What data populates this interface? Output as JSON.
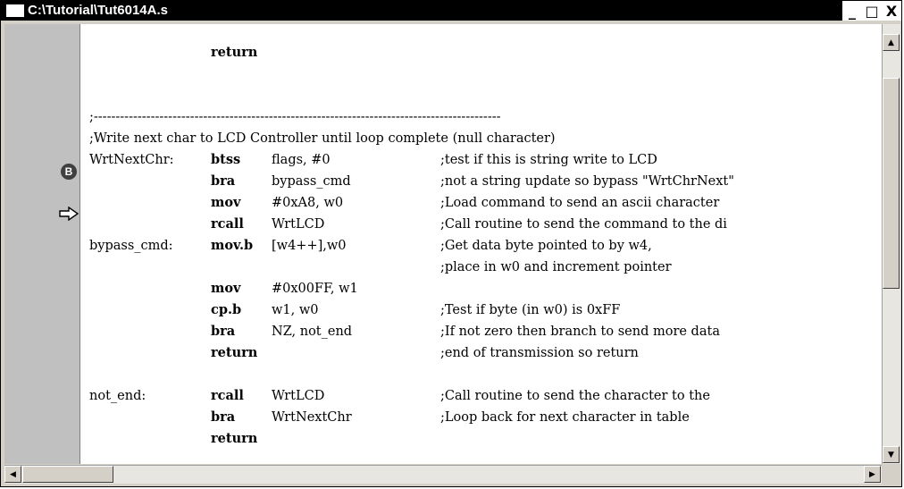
{
  "window": {
    "title": "C:\\Tutorial\\Tut6014A.s",
    "minimize_glyph": "_",
    "maximize_glyph": "□",
    "close_glyph": "X"
  },
  "gutter": {
    "breakpoint_marker": "B",
    "breakpoint_icon": "breakpoint-icon",
    "execution_arrow_icon": "arrow-right-icon"
  },
  "code": {
    "lines": [
      {
        "label": "",
        "mnemonic": "return",
        "operands": "",
        "comment": ""
      },
      {
        "label": "",
        "mnemonic": "",
        "operands": "",
        "comment": ""
      },
      {
        "label": "",
        "mnemonic": "",
        "operands": "",
        "comment": ""
      },
      {
        "label": ";---------------------------------------------------------------------------------------------",
        "mnemonic": "",
        "operands": "",
        "comment": ""
      },
      {
        "label": ";Write next char to LCD Controller until loop complete (null character)",
        "mnemonic": "",
        "operands": "",
        "comment": ""
      },
      {
        "label": "WrtNextChr:",
        "mnemonic": "btss",
        "operands": "flags, #0",
        "comment": ";test if this is string write to LCD"
      },
      {
        "label": "",
        "mnemonic": "bra",
        "operands": "bypass_cmd",
        "comment": ";not a string update so bypass \"WrtChrNext\""
      },
      {
        "label": "",
        "mnemonic": "mov",
        "operands": "#0xA8, w0",
        "comment": ";Load command to send an ascii character"
      },
      {
        "label": "",
        "mnemonic": "rcall",
        "operands": "WrtLCD",
        "comment": ";Call routine to send the command to the di"
      },
      {
        "label": "bypass_cmd:",
        "mnemonic": "mov.b",
        "operands": "[w4++],w0",
        "comment": ";Get data byte pointed to by w4,"
      },
      {
        "label": "",
        "mnemonic": "",
        "operands": "",
        "comment": ";place in w0 and increment pointer"
      },
      {
        "label": "",
        "mnemonic": "mov",
        "operands": "#0x00FF, w1",
        "comment": ""
      },
      {
        "label": "",
        "mnemonic": "cp.b",
        "operands": "w1, w0",
        "comment": ";Test if byte (in w0) is 0xFF"
      },
      {
        "label": "",
        "mnemonic": "bra",
        "operands": "NZ, not_end",
        "comment": ";If not zero then branch to send more data"
      },
      {
        "label": "",
        "mnemonic": "return",
        "operands": "",
        "comment": ";end of transmission so return"
      },
      {
        "label": "",
        "mnemonic": "",
        "operands": "",
        "comment": ""
      },
      {
        "label": "not_end:",
        "mnemonic": "rcall",
        "operands": "WrtLCD",
        "comment": ";Call routine to send the character to the"
      },
      {
        "label": "",
        "mnemonic": "bra",
        "operands": "WrtNextChr",
        "comment": ";Loop back for next character in table"
      },
      {
        "label": "",
        "mnemonic": "return",
        "operands": "",
        "comment": ""
      }
    ]
  },
  "scrollbar": {
    "up_glyph": "▲",
    "down_glyph": "▼",
    "left_glyph": "◀",
    "right_glyph": "▶"
  }
}
